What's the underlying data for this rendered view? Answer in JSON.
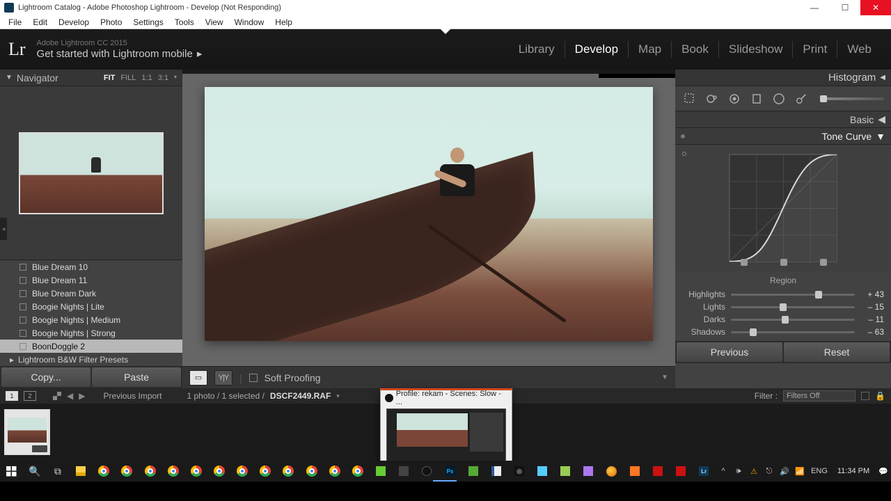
{
  "window": {
    "title": "Lightroom Catalog - Adobe Photoshop Lightroom - Develop (Not Responding)"
  },
  "menu": [
    "File",
    "Edit",
    "Develop",
    "Photo",
    "Settings",
    "Tools",
    "View",
    "Window",
    "Help"
  ],
  "identity": {
    "line1": "Adobe Lightroom CC 2015",
    "line2": "Get started with Lightroom mobile"
  },
  "modules": [
    "Library",
    "Develop",
    "Map",
    "Book",
    "Slideshow",
    "Print",
    "Web"
  ],
  "active_module": "Develop",
  "left": {
    "navigator_label": "Navigator",
    "zoom": [
      "FIT",
      "FILL",
      "1:1",
      "3:1"
    ],
    "zoom_active": "FIT",
    "presets": [
      "Blue Dream 10",
      "Blue Dream 11",
      "Blue Dream Dark",
      "Boogie Nights | Lite",
      "Boogie Nights | Medium",
      "Boogie Nights | Strong",
      "BoonDoggle 2"
    ],
    "preset_selected_index": 6,
    "preset_folder": "Lightroom B&W Filter Presets",
    "copy_label": "Copy...",
    "paste_label": "Paste"
  },
  "toolbar": {
    "soft_proofing": "Soft Proofing"
  },
  "right": {
    "histogram_label": "Histogram",
    "basic_label": "Basic",
    "tone_curve_label": "Tone Curve",
    "region_label": "Region",
    "sliders": [
      {
        "name": "Highlights",
        "value": "+ 43",
        "pos": 71
      },
      {
        "name": "Lights",
        "value": "– 15",
        "pos": 42
      },
      {
        "name": "Darks",
        "value": "– 11",
        "pos": 44
      },
      {
        "name": "Shadows",
        "value": "– 63",
        "pos": 18
      }
    ],
    "previous_label": "Previous",
    "reset_label": "Reset"
  },
  "filmstrip": {
    "mon1": "1",
    "mon2": "2",
    "prev_import": "Previous Import",
    "count_text": "1 photo / 1 selected /",
    "filename": "DSCF2449.RAF",
    "filter_label": "Filter :",
    "filter_value": "Filters Off"
  },
  "popup": {
    "title": "Profile: rekam - Scenes: Slow - ..."
  },
  "systray": {
    "lang": "ENG",
    "time": "11:34 PM"
  }
}
